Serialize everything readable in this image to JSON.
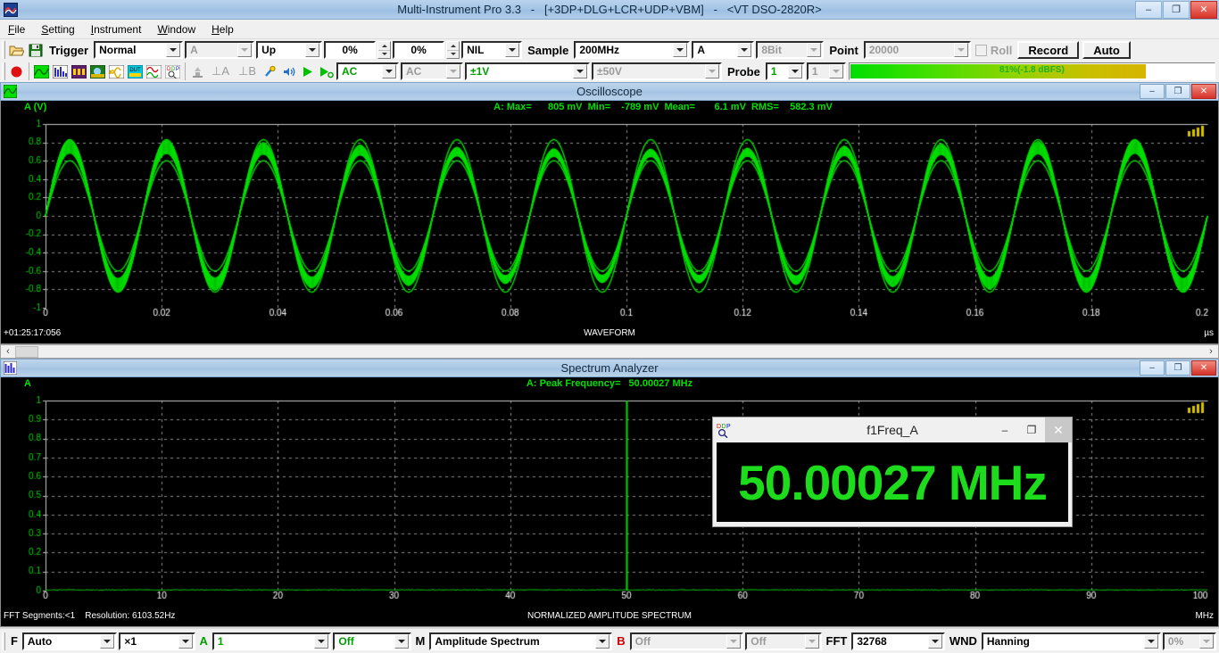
{
  "window": {
    "title": "Multi-Instrument Pro 3.3   -   [+3DP+DLG+LCR+UDP+VBM]   -   <VT DSO-2820R>",
    "logo_icon": "waveform-logo-icon",
    "minimize": "–",
    "maximize": "❐",
    "close": "✕"
  },
  "menu": {
    "items": [
      {
        "label": "File",
        "accel": "F"
      },
      {
        "label": "Setting",
        "accel": "S"
      },
      {
        "label": "Instrument",
        "accel": "I"
      },
      {
        "label": "Window",
        "accel": "W"
      },
      {
        "label": "Help",
        "accel": "H"
      }
    ]
  },
  "toolbar_top": {
    "open_icon": "open-folder-icon",
    "save_icon": "save-disk-icon",
    "trigger_label": "Trigger",
    "trigger_mode": "Normal",
    "trigger_source": "A",
    "trigger_slope": "Up",
    "trigger_level_pct": "0%",
    "trigger_delay_pct": "0%",
    "coupling_nil": "NIL",
    "sample_label": "Sample",
    "sample_rate": "200MHz",
    "channel": "A",
    "resolution": "8Bit",
    "point_label": "Point",
    "record_length": "20000",
    "roll_label": "Roll",
    "record_button": "Record",
    "auto_button": "Auto"
  },
  "toolbar_bottom": {
    "icons": [
      "record-red-dot-icon",
      "oscilloscope-icon",
      "spectrum-analyzer-icon",
      "multimeter-icon",
      "data-logger-icon",
      "signal-generator-icon",
      "device-test-plan-icon",
      "lcr-meter-icon",
      "ddp-viewer-icon",
      "pump-icon",
      "ground-a-icon",
      "ground-b-icon",
      "probe-compensation-icon",
      "sound-card-icon",
      "run-play-icon",
      "step-run-icon"
    ],
    "ground_a": "⊥A",
    "ground_b": "⊥B",
    "coupling_a": "AC",
    "coupling_b": "AC",
    "range_a": "±1V",
    "range_b": "±50V",
    "probe_label": "Probe",
    "probe_a": "1",
    "probe_b": "1",
    "level_text": "81%(-1.8 dBFS)",
    "level_percent": 81
  },
  "oscilloscope": {
    "icon": "oscilloscope-icon",
    "title": "Oscilloscope",
    "minimize": "–",
    "maximize": "❐",
    "close": "✕",
    "y_axis_label": "A (V)",
    "measurements": "A: Max=      805 mV  Min=    -789 mV  Mean=       6.1 mV  RMS=    582.3 mV",
    "timestamp": "+01:25:17:056",
    "footer_label": "WAVEFORM",
    "x_unit": "µs"
  },
  "spectrum": {
    "icon": "spectrum-analyzer-icon",
    "title": "Spectrum Analyzer",
    "minimize": "–",
    "maximize": "❐",
    "close": "✕",
    "y_axis_label": "A",
    "peak_text": "A: Peak Frequency=   50.00027 MHz",
    "status": "FFT Segments:<1    Resolution: 6103.52Hz",
    "footer_label": "NORMALIZED AMPLITUDE SPECTRUM",
    "x_unit": "MHz"
  },
  "freq_window": {
    "icon": "ddp-viewer-icon",
    "title": "f1Freq_A",
    "value": "50.00027 MHz",
    "minimize": "–",
    "maximize": "❐",
    "close": "✕"
  },
  "bottombar": {
    "f_label": "F",
    "f_mode": "Auto",
    "f_mult": "×1",
    "a_label": "A",
    "a_value": "1",
    "a_off": "Off",
    "m_label": "M",
    "m_value": "Amplitude Spectrum",
    "b_label": "B",
    "b_value": "Off",
    "b_off": "Off",
    "fft_label": "FFT",
    "fft_size": "32768",
    "wnd_label": "WND",
    "window_fn": "Hanning",
    "overlap": "0%"
  },
  "colors": {
    "trace_green": "#00e000",
    "grid_gray": "#909090",
    "plot_bg": "#000000",
    "accent_blue": "#a9c7e4"
  },
  "chart_data": [
    {
      "type": "line",
      "name": "oscilloscope-waveform",
      "title": "WAVEFORM",
      "xlabel": "µs",
      "ylabel": "A (V)",
      "xlim": [
        0,
        0.2
      ],
      "ylim": [
        -1,
        1
      ],
      "xticks": [
        0,
        0.02,
        0.04,
        0.06,
        0.08,
        0.1,
        0.12,
        0.14,
        0.16,
        0.18,
        0.2
      ],
      "yticks": [
        -1,
        -0.8,
        -0.6,
        -0.4,
        -0.2,
        0,
        0.2,
        0.4,
        0.6,
        0.8,
        1
      ],
      "grid": true,
      "signal": {
        "description": "50.00027 MHz sine aliased at 200 MHz sample rate; thick green band from sample-to-sample jitter, envelope between 0.60 and 0.83 V peak",
        "carrier_cycles_visible": 12,
        "envelope_max": 0.83,
        "envelope_min": 0.6,
        "beat_cycles": 12
      },
      "measurements": {
        "max_mV": 805,
        "min_mV": -789,
        "mean_mV": 6.1,
        "rms_mV": 582.3
      }
    },
    {
      "type": "line",
      "name": "spectrum-analyzer",
      "title": "NORMALIZED AMPLITUDE SPECTRUM",
      "xlabel": "MHz",
      "ylabel": "A",
      "xlim": [
        0,
        100
      ],
      "ylim": [
        0,
        1
      ],
      "xticks": [
        0,
        10,
        20,
        30,
        40,
        50,
        60,
        70,
        80,
        90,
        100
      ],
      "yticks": [
        0,
        0.1,
        0.2,
        0.3,
        0.4,
        0.5,
        0.6,
        0.7,
        0.8,
        0.9,
        1
      ],
      "grid": true,
      "peaks": [
        {
          "frequency_MHz": 50.00027,
          "amplitude": 1.0
        }
      ],
      "noise_floor": 0.004,
      "resolution_Hz": 6103.52
    }
  ]
}
